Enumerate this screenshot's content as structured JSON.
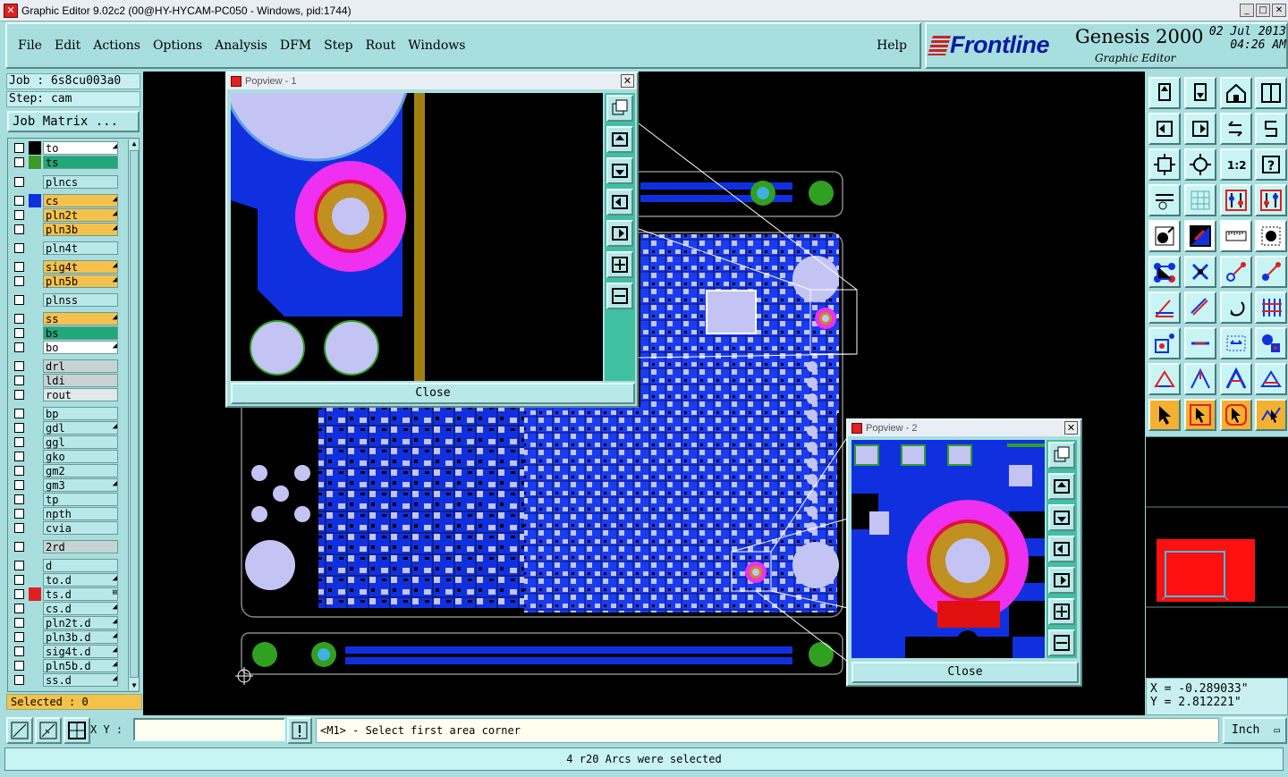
{
  "window": {
    "title": "Graphic Editor 9.02c2 (00@HY-HYCAM-PC050 - Windows, pid:1744)",
    "minimize": "_",
    "maximize": "□",
    "close": "✕"
  },
  "menu": {
    "items": [
      "File",
      "Edit",
      "Actions",
      "Options",
      "Analysis",
      "DFM",
      "Step",
      "Rout",
      "Windows"
    ],
    "help": "Help"
  },
  "brand": {
    "logo": "Frontline",
    "product": "Genesis 2000",
    "subtitle": "Graphic Editor",
    "date": "02 Jul 2013",
    "time": "04:26 AM"
  },
  "job": {
    "job_line": "Job : 6s8cu003a0",
    "step_line": "Step: cam",
    "matrix_button": "Job Matrix ..."
  },
  "layers": [
    {
      "name": "to",
      "fill": "#ffffff",
      "swatch": "#000000",
      "arrow": "◢"
    },
    {
      "name": "ts",
      "fill": "#20a878",
      "swatch": "#3c9a2a",
      "arrow": ""
    },
    {
      "name": "plncs",
      "fill": "#b8e8e8",
      "swatch": "",
      "arrow": ""
    },
    {
      "name": "cs",
      "fill": "#f4c24c",
      "swatch": "#1030e0",
      "arrow": "◢"
    },
    {
      "name": "pln2t",
      "fill": "#f4c24c",
      "swatch": "",
      "arrow": "◢"
    },
    {
      "name": "pln3b",
      "fill": "#f4c24c",
      "swatch": "",
      "arrow": "◢"
    },
    {
      "name": "pln4t",
      "fill": "#b8e8e8",
      "swatch": "",
      "arrow": ""
    },
    {
      "name": "sig4t",
      "fill": "#f4c24c",
      "swatch": "",
      "arrow": "◢"
    },
    {
      "name": "pln5b",
      "fill": "#f4c24c",
      "swatch": "",
      "arrow": "◢"
    },
    {
      "name": "plnss",
      "fill": "#b8e8e8",
      "swatch": "",
      "arrow": ""
    },
    {
      "name": "ss",
      "fill": "#f4c24c",
      "swatch": "",
      "arrow": "◢"
    },
    {
      "name": "bs",
      "fill": "#20a878",
      "swatch": "",
      "arrow": ""
    },
    {
      "name": "bo",
      "fill": "#ffffff",
      "swatch": "",
      "arrow": "◢"
    },
    {
      "name": "drl",
      "fill": "#c8d4d4",
      "swatch": "",
      "arrow": ""
    },
    {
      "name": "ldi",
      "fill": "#c8d4d4",
      "swatch": "",
      "arrow": ""
    },
    {
      "name": "rout",
      "fill": "#e0e8e8",
      "swatch": "",
      "arrow": ""
    },
    {
      "name": "bp",
      "fill": "#b8e8e8",
      "swatch": "",
      "arrow": ""
    },
    {
      "name": "gdl",
      "fill": "#b8e8e8",
      "swatch": "",
      "arrow": "◢"
    },
    {
      "name": "ggl",
      "fill": "#b8e8e8",
      "swatch": "",
      "arrow": ""
    },
    {
      "name": "gko",
      "fill": "#b8e8e8",
      "swatch": "",
      "arrow": ""
    },
    {
      "name": "gm2",
      "fill": "#b8e8e8",
      "swatch": "",
      "arrow": ""
    },
    {
      "name": "gm3",
      "fill": "#b8e8e8",
      "swatch": "",
      "arrow": "◢"
    },
    {
      "name": "tp",
      "fill": "#b8e8e8",
      "swatch": "",
      "arrow": ""
    },
    {
      "name": "npth",
      "fill": "#b8e8e8",
      "swatch": "",
      "arrow": ""
    },
    {
      "name": "cvia",
      "fill": "#b8e8e8",
      "swatch": "",
      "arrow": ""
    },
    {
      "name": "2rd",
      "fill": "#c8d4d4",
      "swatch": "",
      "arrow": ""
    },
    {
      "name": "d",
      "fill": "#b8e8e8",
      "swatch": "",
      "arrow": ""
    },
    {
      "name": "to.d",
      "fill": "#b8e8e8",
      "swatch": "",
      "arrow": "◢"
    },
    {
      "name": "ts.d",
      "fill": "#b8e8e8",
      "swatch": "#e02020",
      "arrow": "⊞"
    },
    {
      "name": "cs.d",
      "fill": "#b8e8e8",
      "swatch": "",
      "arrow": "◢"
    },
    {
      "name": "pln2t.d",
      "fill": "#b8e8e8",
      "swatch": "",
      "arrow": "◢"
    },
    {
      "name": "pln3b.d",
      "fill": "#b8e8e8",
      "swatch": "",
      "arrow": "◢"
    },
    {
      "name": "sig4t.d",
      "fill": "#b8e8e8",
      "swatch": "",
      "arrow": "◢"
    },
    {
      "name": "pln5b.d",
      "fill": "#b8e8e8",
      "swatch": "",
      "arrow": "◢"
    },
    {
      "name": "ss.d",
      "fill": "#b8e8e8",
      "swatch": "",
      "arrow": "◢"
    }
  ],
  "selected": "Selected : 0",
  "popview1": {
    "title": "Popview - 1",
    "close": "Close"
  },
  "popview2": {
    "title": "Popview - 2",
    "close": "Close"
  },
  "coords": {
    "x": "X = -0.289033\"",
    "y": "Y =  2.812221\""
  },
  "bottom": {
    "xy_label": "X Y :",
    "xy_value": "",
    "prompt": "<M1> - Select first area corner",
    "unit": "Inch"
  },
  "status": "4 r20 Arcs were selected",
  "colors": {
    "background_panel": "#a8dede",
    "copper_blue": "#1030e0",
    "pad_lavender": "#c4c4f4",
    "annular_magenta": "#f030f0",
    "annular_gold": "#c09020",
    "green_pad": "#30a020"
  }
}
